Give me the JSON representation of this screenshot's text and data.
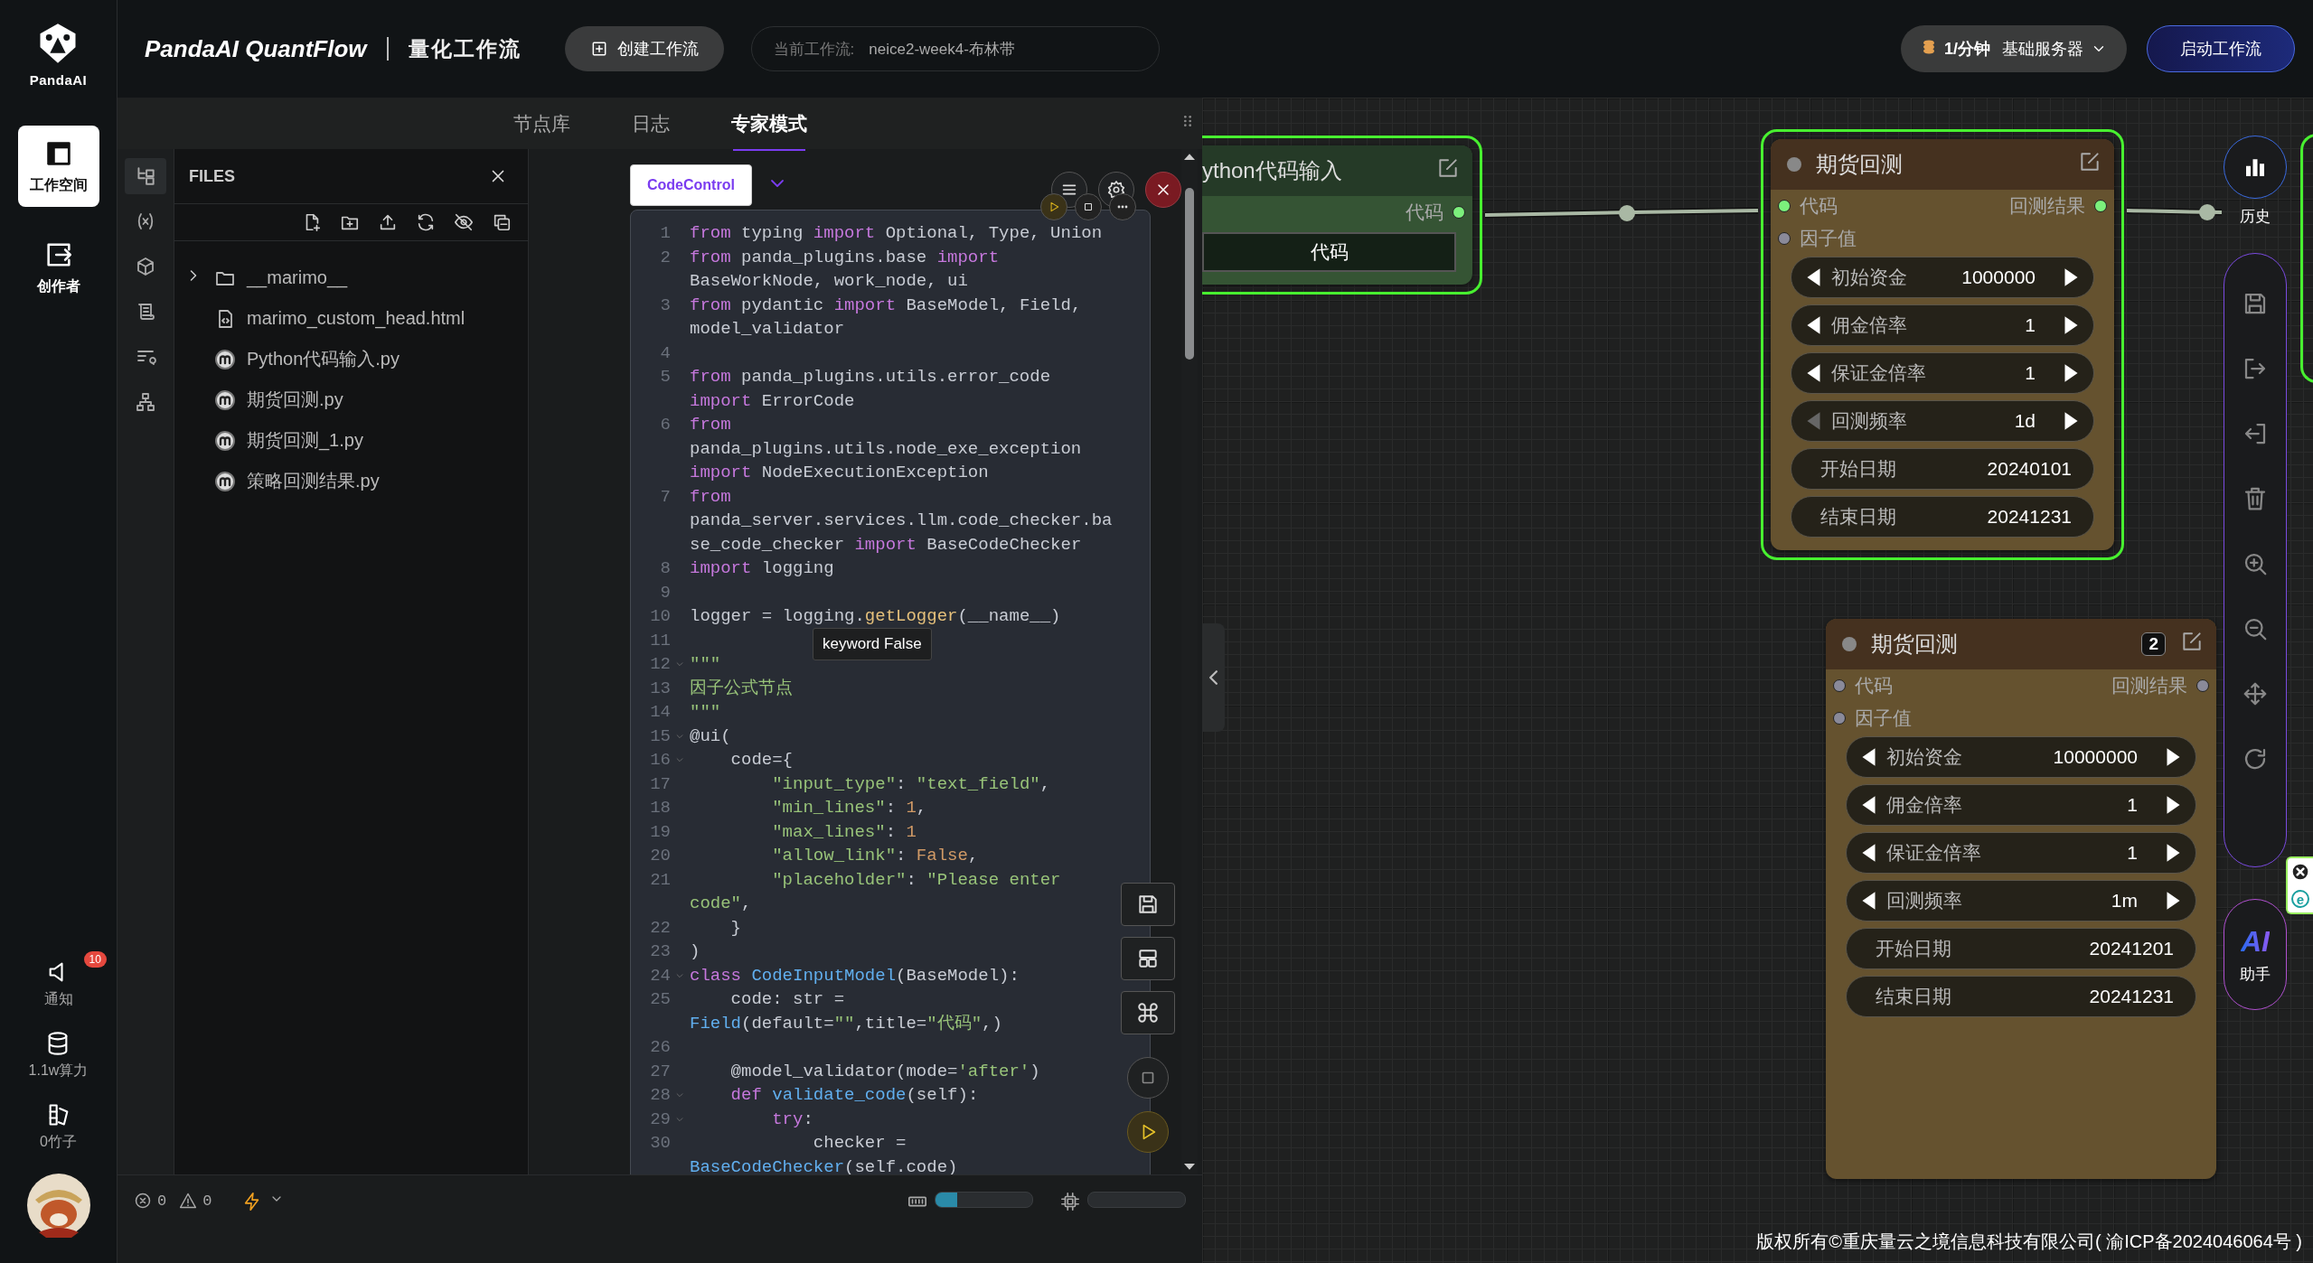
{
  "rail": {
    "logo": "PandaAI",
    "items": [
      {
        "label": "工作空间",
        "selected": true
      },
      {
        "label": "创作者",
        "selected": false
      }
    ],
    "bottom": [
      {
        "label": "通知",
        "badge": "10"
      },
      {
        "label": "1.1w算力"
      },
      {
        "label": "0竹子"
      }
    ]
  },
  "header": {
    "title": "PandaAI QuantFlow",
    "subtitle": "量化工作流",
    "create_button": "创建工作流",
    "current_label": "当前工作流:",
    "current_value": "neice2-week4-布林带",
    "server_rate": "1/分钟",
    "server_name": "基础服务器",
    "start_button": "启动工作流"
  },
  "panel_tabs": [
    {
      "label": "节点库",
      "selected": false
    },
    {
      "label": "日志",
      "selected": false
    },
    {
      "label": "专家模式",
      "selected": true
    }
  ],
  "files": {
    "title": "FILES",
    "items": [
      {
        "name": "__marimo__",
        "kind": "folder",
        "expanded": false
      },
      {
        "name": "marimo_custom_head.html",
        "kind": "html"
      },
      {
        "name": "Python代码输入.py",
        "kind": "marimo"
      },
      {
        "name": "期货回测.py",
        "kind": "marimo"
      },
      {
        "name": "期货回测_1.py",
        "kind": "marimo"
      },
      {
        "name": "策略回测结果.py",
        "kind": "marimo"
      }
    ]
  },
  "editor": {
    "tab": "CodeControl",
    "tooltip": "keyword False",
    "lines": [
      {
        "n": "1",
        "fold": false,
        "tokens": [
          {
            "kind": "kw",
            "text": "from"
          },
          {
            "kind": "t",
            "text": " typing "
          },
          {
            "kind": "kw",
            "text": "import"
          },
          {
            "kind": "t",
            "text": " Optional, Type, Union"
          }
        ]
      },
      {
        "n": "2",
        "fold": false,
        "tokens": [
          {
            "kind": "kw",
            "text": "from"
          },
          {
            "kind": "t",
            "text": " panda_plugins.base "
          },
          {
            "kind": "kw",
            "text": "import"
          },
          {
            "kind": "t",
            "text": " BaseWorkNode, work_node, ui"
          }
        ]
      },
      {
        "n": "3",
        "fold": false,
        "tokens": [
          {
            "kind": "kw",
            "text": "from"
          },
          {
            "kind": "t",
            "text": " pydantic "
          },
          {
            "kind": "kw",
            "text": "import"
          },
          {
            "kind": "t",
            "text": " BaseModel, Field, model_validator"
          }
        ]
      },
      {
        "n": "4",
        "fold": false
      },
      {
        "n": "5",
        "fold": false,
        "tokens": [
          {
            "kind": "kw",
            "text": "from"
          },
          {
            "kind": "t",
            "text": " panda_plugins.utils.error_code "
          },
          {
            "kind": "kw",
            "text": "import"
          },
          {
            "kind": "t",
            "text": " ErrorCode"
          }
        ]
      },
      {
        "n": "6",
        "fold": false,
        "tokens": [
          {
            "kind": "kw",
            "text": "from"
          },
          {
            "kind": "t",
            "text": " panda_plugins.utils.node_exe_exception "
          },
          {
            "kind": "kw",
            "text": "import"
          },
          {
            "kind": "t",
            "text": " NodeExecutionException"
          }
        ]
      },
      {
        "n": "7",
        "fold": false,
        "tokens": [
          {
            "kind": "kw",
            "text": "from"
          },
          {
            "kind": "t",
            "text": " panda_server.services.llm.code_checker.base_code_checker "
          },
          {
            "kind": "kw",
            "text": "import"
          },
          {
            "kind": "t",
            "text": " BaseCodeChecker"
          }
        ]
      },
      {
        "n": "8",
        "fold": false,
        "tokens": [
          {
            "kind": "kw",
            "text": "import"
          },
          {
            "kind": "t",
            "text": " logging"
          }
        ]
      },
      {
        "n": "9",
        "fold": false
      },
      {
        "n": "10",
        "fold": false,
        "tokens": [
          {
            "kind": "t",
            "text": "logger = logging."
          },
          {
            "kind": "call",
            "text": "getLogger"
          },
          {
            "kind": "t",
            "text": "(__name__)"
          }
        ]
      },
      {
        "n": "11",
        "fold": false
      },
      {
        "n": "12",
        "fold": true,
        "tokens": [
          {
            "kind": "str",
            "text": "\"\"\""
          }
        ]
      },
      {
        "n": "13",
        "fold": false,
        "tokens": [
          {
            "kind": "str",
            "text": "因子公式节点"
          }
        ]
      },
      {
        "n": "14",
        "fold": false,
        "tokens": [
          {
            "kind": "str",
            "text": "\"\"\""
          }
        ]
      },
      {
        "n": "15",
        "fold": true,
        "tokens": [
          {
            "kind": "t",
            "text": "@ui("
          }
        ]
      },
      {
        "n": "16",
        "fold": true,
        "tokens": [
          {
            "kind": "t",
            "text": "    code={"
          }
        ]
      },
      {
        "n": "17",
        "fold": false,
        "tokens": [
          {
            "kind": "str",
            "text": "        \"input_type\""
          },
          {
            "kind": "t",
            "text": ": "
          },
          {
            "kind": "str",
            "text": "\"text_field\""
          },
          {
            "kind": "t",
            "text": ","
          }
        ]
      },
      {
        "n": "18",
        "fold": false,
        "tokens": [
          {
            "kind": "str",
            "text": "        \"min_lines\""
          },
          {
            "kind": "t",
            "text": ": "
          },
          {
            "kind": "num",
            "text": "1"
          },
          {
            "kind": "t",
            "text": ","
          }
        ]
      },
      {
        "n": "19",
        "fold": false,
        "tokens": [
          {
            "kind": "str",
            "text": "        \"max_lines\""
          },
          {
            "kind": "t",
            "text": ": "
          },
          {
            "kind": "num",
            "text": "1"
          }
        ]
      },
      {
        "n": "20",
        "fold": false,
        "tokens": [
          {
            "kind": "str",
            "text": "        \"allow_link\""
          },
          {
            "kind": "t",
            "text": ": "
          },
          {
            "kind": "num",
            "text": "False"
          },
          {
            "kind": "t",
            "text": ","
          }
        ]
      },
      {
        "n": "21",
        "fold": false,
        "tokens": [
          {
            "kind": "str",
            "text": "        \"placeholder\""
          },
          {
            "kind": "t",
            "text": ": "
          },
          {
            "kind": "str",
            "text": "\"Please enter code\""
          },
          {
            "kind": "t",
            "text": ","
          }
        ]
      },
      {
        "n": "22",
        "fold": false,
        "tokens": [
          {
            "kind": "t",
            "text": "    }"
          }
        ]
      },
      {
        "n": "23",
        "fold": false,
        "tokens": [
          {
            "kind": "t",
            "text": ")"
          }
        ]
      },
      {
        "n": "24",
        "fold": true,
        "tokens": [
          {
            "kind": "kw",
            "text": "class"
          },
          {
            "kind": "fn",
            "text": " CodeInputModel"
          },
          {
            "kind": "t",
            "text": "(BaseModel):"
          }
        ]
      },
      {
        "n": "25",
        "fold": false,
        "tokens": [
          {
            "kind": "t",
            "text": "    code: str = "
          },
          {
            "kind": "fn",
            "text": "Field"
          },
          {
            "kind": "t",
            "text": "(default="
          },
          {
            "kind": "str",
            "text": "\"\""
          },
          {
            "kind": "t",
            "text": ",title="
          },
          {
            "kind": "str",
            "text": "\"代码\""
          },
          {
            "kind": "t",
            "text": ",)"
          }
        ]
      },
      {
        "n": "26",
        "fold": false
      },
      {
        "n": "27",
        "fold": false,
        "tokens": [
          {
            "kind": "t",
            "text": "    @model_validator(mode="
          },
          {
            "kind": "str",
            "text": "'after'"
          },
          {
            "kind": "t",
            "text": ")"
          }
        ]
      },
      {
        "n": "28",
        "fold": true,
        "tokens": [
          {
            "kind": "kw",
            "text": "    def"
          },
          {
            "kind": "fn",
            "text": " validate_code"
          },
          {
            "kind": "t",
            "text": "(self):"
          }
        ]
      },
      {
        "n": "29",
        "fold": true,
        "tokens": [
          {
            "kind": "kw",
            "text": "        try"
          },
          {
            "kind": "t",
            "text": ":"
          }
        ]
      },
      {
        "n": "30",
        "fold": false,
        "tokens": [
          {
            "kind": "t",
            "text": "            checker = "
          },
          {
            "kind": "fn",
            "text": "BaseCodeChecker"
          },
          {
            "kind": "t",
            "text": "(self.code)"
          }
        ]
      }
    ]
  },
  "status": {
    "errors": "0",
    "warnings": "0",
    "memory": {
      "level": 0.22
    },
    "cpu": {
      "level": 0
    }
  },
  "nodes": [
    {
      "kind": "input",
      "title": "ython代码输入",
      "selected": true,
      "outputs": [
        {
          "label": "代码",
          "connected": true
        }
      ],
      "field": "代码"
    },
    {
      "kind": "backtest",
      "title": "期货回测",
      "selected": true,
      "inputs": [
        {
          "label": "代码",
          "connected": true
        },
        {
          "label": "因子值",
          "connected": false
        }
      ],
      "outputs": [
        {
          "label": "回测结果",
          "connected": true
        }
      ],
      "params": [
        {
          "kind": "stepper",
          "label": "初始资金",
          "value": "1000000",
          "left_enabled": true
        },
        {
          "kind": "stepper",
          "label": "佣金倍率",
          "value": "1",
          "left_enabled": true
        },
        {
          "kind": "stepper",
          "label": "保证金倍率",
          "value": "1",
          "left_enabled": true
        },
        {
          "kind": "stepper",
          "label": "回测频率",
          "value": "1d",
          "left_enabled": false
        },
        {
          "kind": "field",
          "label": "开始日期",
          "value": "20240101"
        },
        {
          "kind": "field",
          "label": "结束日期",
          "value": "20241231"
        }
      ]
    },
    {
      "kind": "backtest",
      "title": "期货回测",
      "selected": false,
      "badge": "2",
      "inputs": [
        {
          "label": "代码",
          "connected": false
        },
        {
          "label": "因子值",
          "connected": false
        }
      ],
      "outputs": [
        {
          "label": "回测结果",
          "connected": false
        }
      ],
      "params": [
        {
          "kind": "stepper",
          "label": "初始资金",
          "value": "10000000",
          "left_enabled": true
        },
        {
          "kind": "stepper",
          "label": "佣金倍率",
          "value": "1",
          "left_enabled": true
        },
        {
          "kind": "stepper",
          "label": "保证金倍率",
          "value": "1",
          "left_enabled": true
        },
        {
          "kind": "stepper",
          "label": "回测频率",
          "value": "1m",
          "left_enabled": true
        },
        {
          "kind": "field",
          "label": "开始日期",
          "value": "20241201"
        },
        {
          "kind": "field",
          "label": "结束日期",
          "value": "20241231"
        }
      ]
    }
  ],
  "toolbar": {
    "history": "历史",
    "ai": "AI",
    "assistant": "助手",
    "extension": "e"
  },
  "footer": "版权所有©重庆量云之境信息科技有限公司( 渝ICP备2024046064号 )"
}
